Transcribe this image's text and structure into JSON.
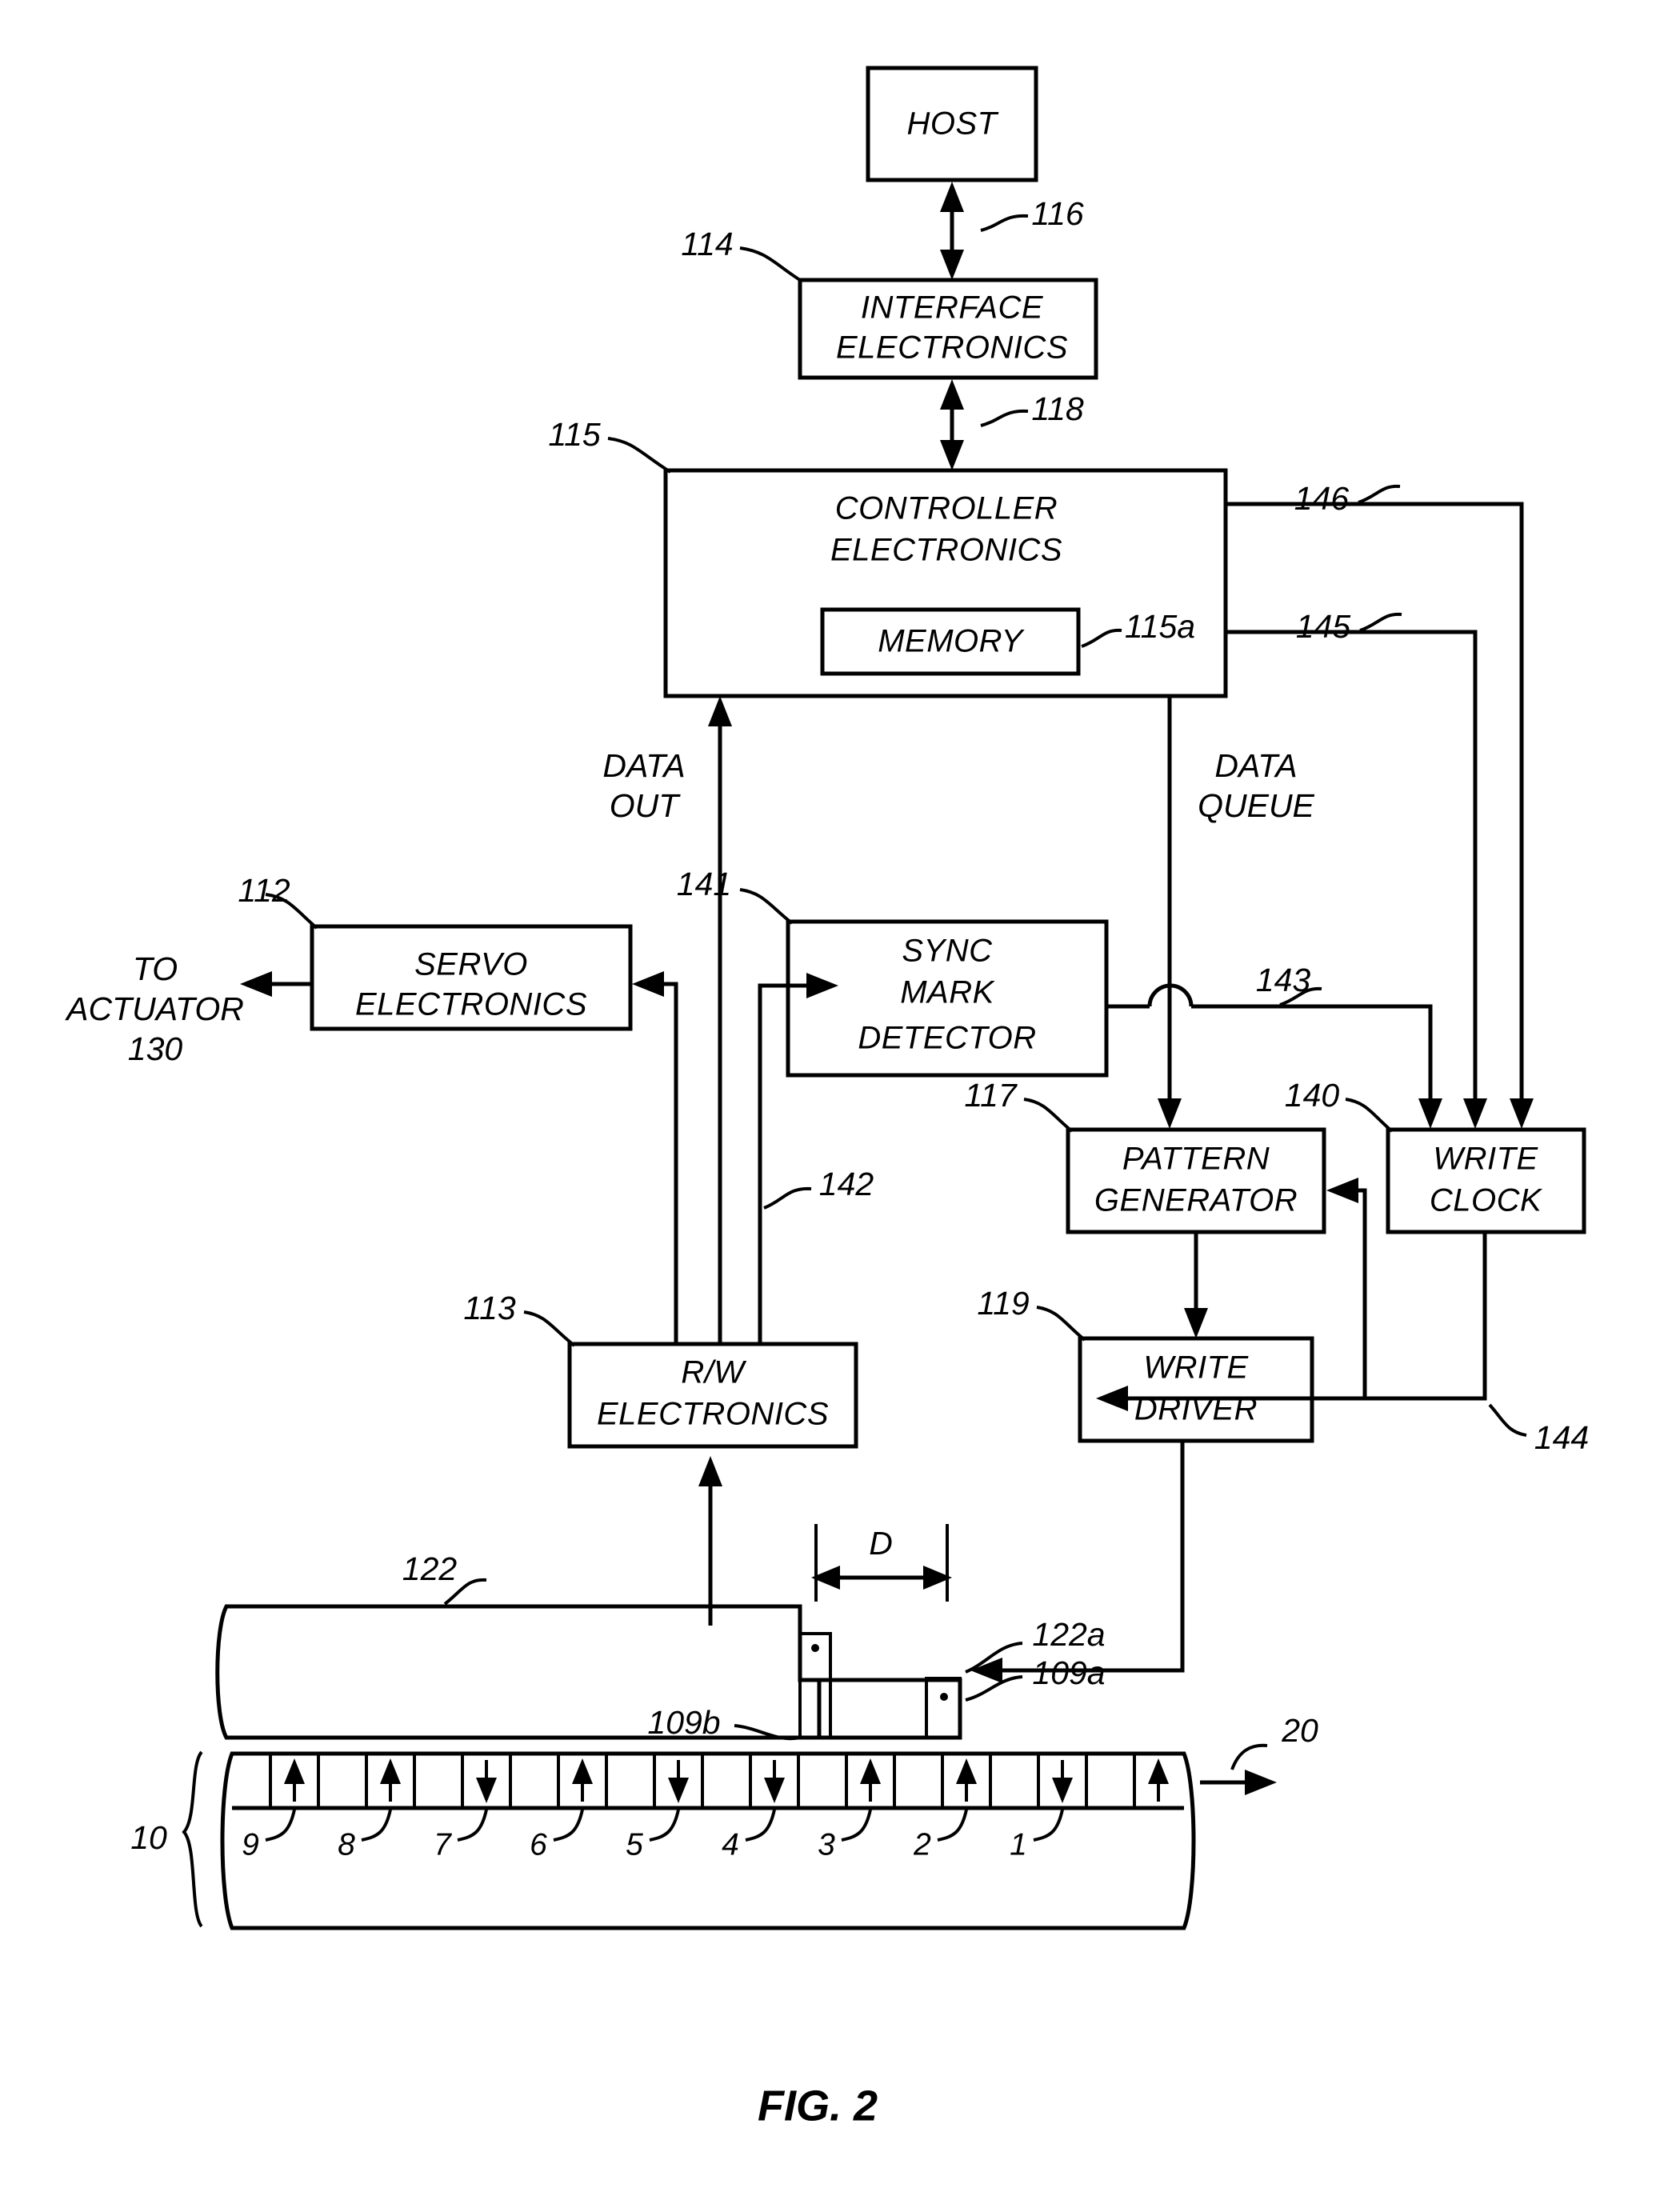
{
  "figure": {
    "caption": "FIG. 2",
    "title": "Disk drive read/write channel block diagram"
  },
  "blocks": {
    "host": {
      "label": "HOST",
      "ref": ""
    },
    "interface_electronics": {
      "label_line1": "INTERFACE",
      "label_line2": "ELECTRONICS",
      "ref": "114"
    },
    "controller_electronics": {
      "label_line1": "CONTROLLER",
      "label_line2": "ELECTRONICS",
      "ref": "115"
    },
    "memory": {
      "label": "MEMORY",
      "ref": "115a"
    },
    "servo_electronics": {
      "label_line1": "SERVO",
      "label_line2": "ELECTRONICS",
      "ref": "112"
    },
    "sync_mark_detector": {
      "label_line1": "SYNC",
      "label_line2": "MARK",
      "label_line3": "DETECTOR",
      "ref": "141"
    },
    "pattern_generator": {
      "label_line1": "PATTERN",
      "label_line2": "GENERATOR",
      "ref": "117"
    },
    "write_clock": {
      "label_line1": "WRITE",
      "label_line2": "CLOCK",
      "ref": "140"
    },
    "rw_electronics": {
      "label_line1": "R/W",
      "label_line2": "ELECTRONICS",
      "ref": "113"
    },
    "write_driver": {
      "label_line1": "WRITE",
      "label_line2": "DRIVER",
      "ref": "119"
    }
  },
  "signals": {
    "host_interface": "116",
    "interface_controller": "118",
    "data_out_line1": "DATA",
    "data_out_line2": "OUT",
    "data_queue_line1": "DATA",
    "data_queue_line2": "QUEUE",
    "rw_to_sync": "142",
    "sync_to_writeclock": "143",
    "writeclock_to_writedriver": "144",
    "controller_to_writeclock_a": "145",
    "controller_to_writeclock_b": "146",
    "to_actuator_line1": "TO",
    "to_actuator_line2": "ACTUATOR",
    "to_actuator_line3": "130"
  },
  "media": {
    "slider_ref": "122",
    "slider_trailing_ref": "122a",
    "read_head_ref": "109b",
    "write_head_ref": "109a",
    "spacing_label": "D",
    "media_bracket_ref": "10",
    "media_direction_ref": "20",
    "cell_numbers": [
      "9",
      "8",
      "7",
      "6",
      "5",
      "4",
      "3",
      "2",
      "1"
    ],
    "magnetization": [
      "up",
      "up",
      "down",
      "up",
      "down",
      "down",
      "up",
      "up",
      "down",
      "up"
    ]
  },
  "colors": {
    "ink": "#000000",
    "paper": "#ffffff"
  }
}
